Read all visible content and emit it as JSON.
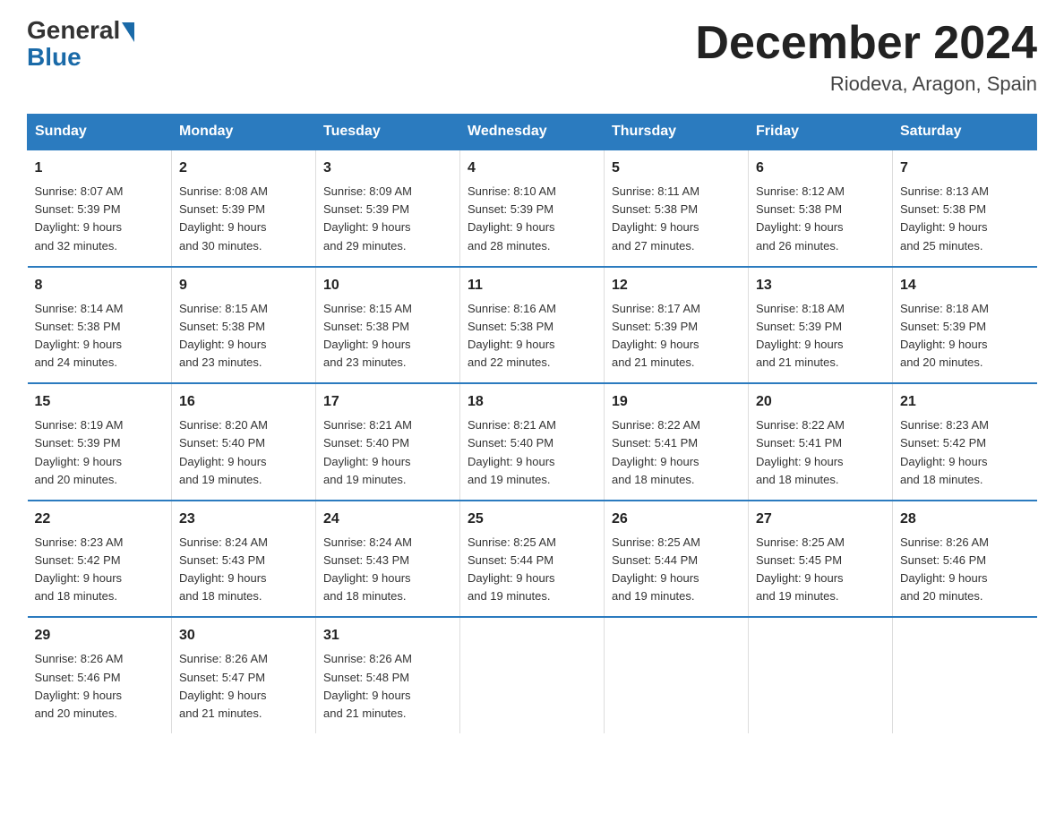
{
  "logo": {
    "general": "General",
    "blue": "Blue"
  },
  "title": {
    "month_year": "December 2024",
    "location": "Riodeva, Aragon, Spain"
  },
  "days_of_week": [
    "Sunday",
    "Monday",
    "Tuesday",
    "Wednesday",
    "Thursday",
    "Friday",
    "Saturday"
  ],
  "weeks": [
    [
      {
        "day": "1",
        "sunrise": "8:07 AM",
        "sunset": "5:39 PM",
        "daylight": "9 hours and 32 minutes."
      },
      {
        "day": "2",
        "sunrise": "8:08 AM",
        "sunset": "5:39 PM",
        "daylight": "9 hours and 30 minutes."
      },
      {
        "day": "3",
        "sunrise": "8:09 AM",
        "sunset": "5:39 PM",
        "daylight": "9 hours and 29 minutes."
      },
      {
        "day": "4",
        "sunrise": "8:10 AM",
        "sunset": "5:39 PM",
        "daylight": "9 hours and 28 minutes."
      },
      {
        "day": "5",
        "sunrise": "8:11 AM",
        "sunset": "5:38 PM",
        "daylight": "9 hours and 27 minutes."
      },
      {
        "day": "6",
        "sunrise": "8:12 AM",
        "sunset": "5:38 PM",
        "daylight": "9 hours and 26 minutes."
      },
      {
        "day": "7",
        "sunrise": "8:13 AM",
        "sunset": "5:38 PM",
        "daylight": "9 hours and 25 minutes."
      }
    ],
    [
      {
        "day": "8",
        "sunrise": "8:14 AM",
        "sunset": "5:38 PM",
        "daylight": "9 hours and 24 minutes."
      },
      {
        "day": "9",
        "sunrise": "8:15 AM",
        "sunset": "5:38 PM",
        "daylight": "9 hours and 23 minutes."
      },
      {
        "day": "10",
        "sunrise": "8:15 AM",
        "sunset": "5:38 PM",
        "daylight": "9 hours and 23 minutes."
      },
      {
        "day": "11",
        "sunrise": "8:16 AM",
        "sunset": "5:38 PM",
        "daylight": "9 hours and 22 minutes."
      },
      {
        "day": "12",
        "sunrise": "8:17 AM",
        "sunset": "5:39 PM",
        "daylight": "9 hours and 21 minutes."
      },
      {
        "day": "13",
        "sunrise": "8:18 AM",
        "sunset": "5:39 PM",
        "daylight": "9 hours and 21 minutes."
      },
      {
        "day": "14",
        "sunrise": "8:18 AM",
        "sunset": "5:39 PM",
        "daylight": "9 hours and 20 minutes."
      }
    ],
    [
      {
        "day": "15",
        "sunrise": "8:19 AM",
        "sunset": "5:39 PM",
        "daylight": "9 hours and 20 minutes."
      },
      {
        "day": "16",
        "sunrise": "8:20 AM",
        "sunset": "5:40 PM",
        "daylight": "9 hours and 19 minutes."
      },
      {
        "day": "17",
        "sunrise": "8:21 AM",
        "sunset": "5:40 PM",
        "daylight": "9 hours and 19 minutes."
      },
      {
        "day": "18",
        "sunrise": "8:21 AM",
        "sunset": "5:40 PM",
        "daylight": "9 hours and 19 minutes."
      },
      {
        "day": "19",
        "sunrise": "8:22 AM",
        "sunset": "5:41 PM",
        "daylight": "9 hours and 18 minutes."
      },
      {
        "day": "20",
        "sunrise": "8:22 AM",
        "sunset": "5:41 PM",
        "daylight": "9 hours and 18 minutes."
      },
      {
        "day": "21",
        "sunrise": "8:23 AM",
        "sunset": "5:42 PM",
        "daylight": "9 hours and 18 minutes."
      }
    ],
    [
      {
        "day": "22",
        "sunrise": "8:23 AM",
        "sunset": "5:42 PM",
        "daylight": "9 hours and 18 minutes."
      },
      {
        "day": "23",
        "sunrise": "8:24 AM",
        "sunset": "5:43 PM",
        "daylight": "9 hours and 18 minutes."
      },
      {
        "day": "24",
        "sunrise": "8:24 AM",
        "sunset": "5:43 PM",
        "daylight": "9 hours and 18 minutes."
      },
      {
        "day": "25",
        "sunrise": "8:25 AM",
        "sunset": "5:44 PM",
        "daylight": "9 hours and 19 minutes."
      },
      {
        "day": "26",
        "sunrise": "8:25 AM",
        "sunset": "5:44 PM",
        "daylight": "9 hours and 19 minutes."
      },
      {
        "day": "27",
        "sunrise": "8:25 AM",
        "sunset": "5:45 PM",
        "daylight": "9 hours and 19 minutes."
      },
      {
        "day": "28",
        "sunrise": "8:26 AM",
        "sunset": "5:46 PM",
        "daylight": "9 hours and 20 minutes."
      }
    ],
    [
      {
        "day": "29",
        "sunrise": "8:26 AM",
        "sunset": "5:46 PM",
        "daylight": "9 hours and 20 minutes."
      },
      {
        "day": "30",
        "sunrise": "8:26 AM",
        "sunset": "5:47 PM",
        "daylight": "9 hours and 21 minutes."
      },
      {
        "day": "31",
        "sunrise": "8:26 AM",
        "sunset": "5:48 PM",
        "daylight": "9 hours and 21 minutes."
      },
      null,
      null,
      null,
      null
    ]
  ],
  "labels": {
    "sunrise": "Sunrise:",
    "sunset": "Sunset:",
    "daylight": "Daylight:"
  }
}
